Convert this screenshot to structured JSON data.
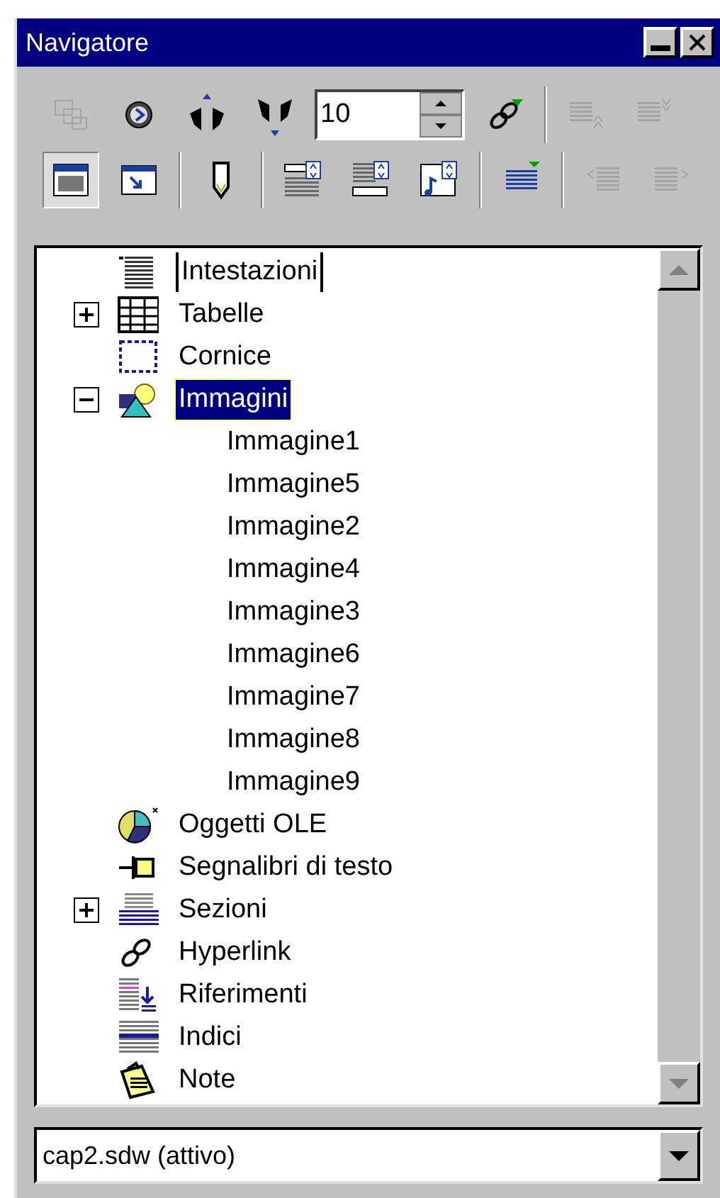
{
  "window": {
    "title": "Navigatore"
  },
  "toolbar": {
    "row_1": [
      {
        "kind": "content",
        "disabled": true,
        "pressed": false
      },
      {
        "kind": "navigation",
        "disabled": false,
        "pressed": false
      },
      {
        "kind": "previous",
        "disabled": false,
        "pressed": false
      },
      {
        "kind": "next",
        "disabled": false,
        "pressed": false
      },
      {
        "kind": "spin",
        "value": "10"
      },
      {
        "kind": "dragmode",
        "disabled": false,
        "pressed": false
      },
      {
        "kind": "separator"
      },
      {
        "kind": "promote-chapter",
        "disabled": true,
        "pressed": false
      },
      {
        "kind": "demote-chapter",
        "disabled": true,
        "pressed": false
      }
    ],
    "row_2": [
      {
        "kind": "listbox",
        "disabled": false,
        "pressed": true
      },
      {
        "kind": "window",
        "disabled": false,
        "pressed": false
      },
      {
        "kind": "separator"
      },
      {
        "kind": "reminder",
        "disabled": false,
        "pressed": false
      },
      {
        "kind": "separator"
      },
      {
        "kind": "header",
        "disabled": false,
        "pressed": false
      },
      {
        "kind": "footer",
        "disabled": false,
        "pressed": false
      },
      {
        "kind": "anchor",
        "disabled": false,
        "pressed": false
      },
      {
        "kind": "separator"
      },
      {
        "kind": "levels",
        "disabled": false,
        "pressed": false
      },
      {
        "kind": "separator"
      },
      {
        "kind": "promote-level",
        "disabled": true,
        "pressed": false
      },
      {
        "kind": "demote-level",
        "disabled": true,
        "pressed": false
      }
    ]
  },
  "tree": {
    "items": [
      {
        "label": "Intestazioni",
        "kind": "headings",
        "selected": false,
        "focused": true
      },
      {
        "label": "Tabelle",
        "kind": "tables",
        "expanded": false,
        "selected": false,
        "focused": false
      },
      {
        "label": "Cornice",
        "kind": "frames",
        "selected": false,
        "focused": false
      },
      {
        "label": "Immagini",
        "kind": "images",
        "expanded": true,
        "selected": true,
        "focused": false,
        "children": [
          {
            "label": "Immagine1",
            "selected": false
          },
          {
            "label": "Immagine5",
            "selected": false
          },
          {
            "label": "Immagine2",
            "selected": false
          },
          {
            "label": "Immagine4",
            "selected": false
          },
          {
            "label": "Immagine3",
            "selected": false
          },
          {
            "label": "Immagine6",
            "selected": false
          },
          {
            "label": "Immagine7",
            "selected": false
          },
          {
            "label": "Immagine8",
            "selected": false
          },
          {
            "label": "Immagine9",
            "selected": false
          }
        ]
      },
      {
        "label": "Oggetti OLE",
        "kind": "ole",
        "selected": false,
        "focused": false
      },
      {
        "label": "Segnalibri di testo",
        "kind": "bookmarks",
        "selected": false,
        "focused": false
      },
      {
        "label": "Sezioni",
        "kind": "sections",
        "expanded": false,
        "selected": false,
        "focused": false
      },
      {
        "label": "Hyperlink",
        "kind": "hyperlinks",
        "selected": false,
        "focused": false
      },
      {
        "label": "Riferimenti",
        "kind": "references",
        "selected": false,
        "focused": false
      },
      {
        "label": "Indici",
        "kind": "indexes",
        "selected": false,
        "focused": false
      },
      {
        "label": "Note",
        "kind": "notes",
        "selected": false,
        "focused": false
      }
    ]
  },
  "document_select": {
    "value": "cap2.sdw (attivo)"
  }
}
